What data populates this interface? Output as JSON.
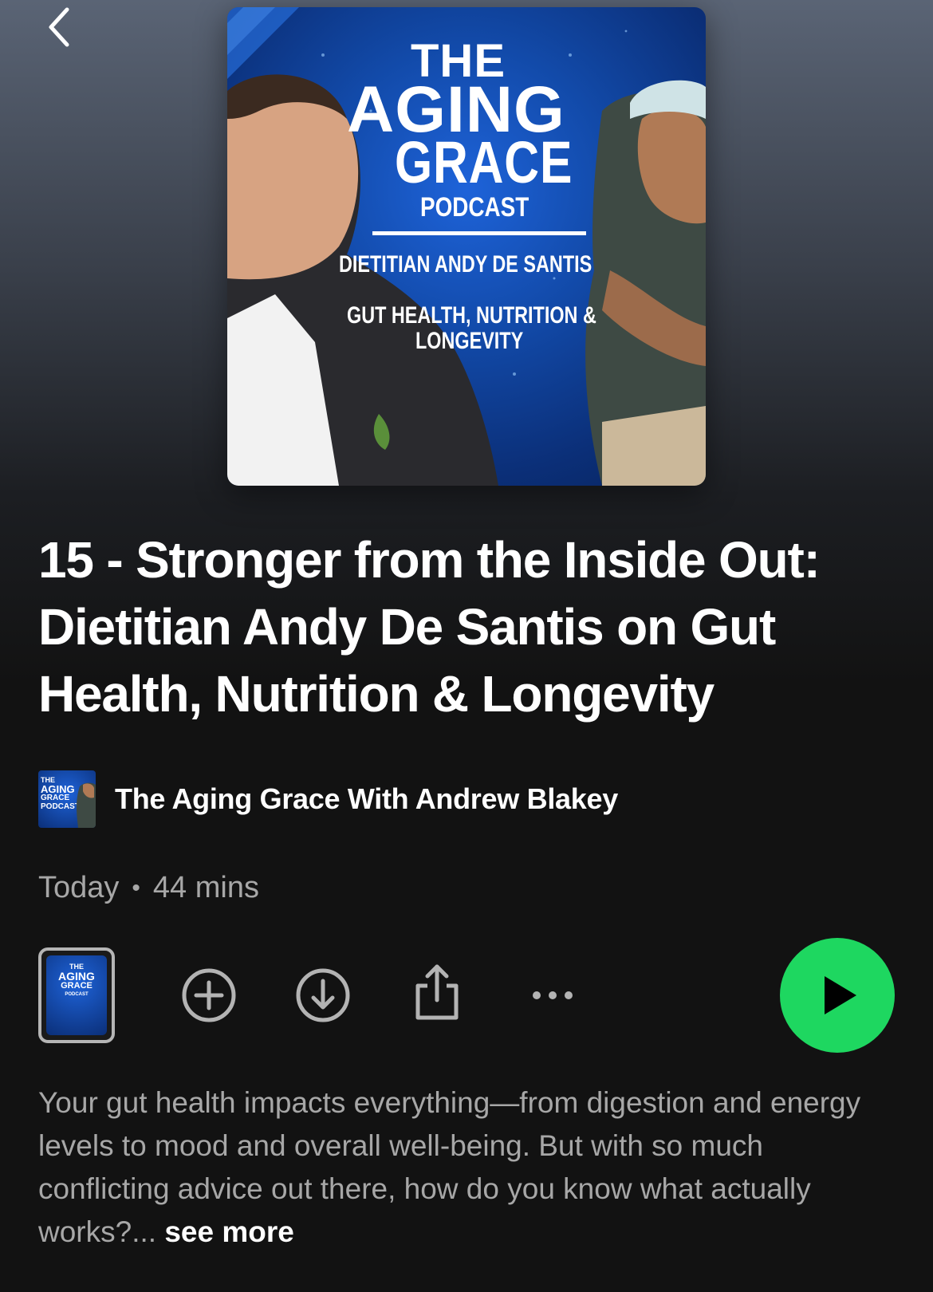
{
  "nav": {
    "back_icon": "chevron-left-icon"
  },
  "cover": {
    "line_the": "THE",
    "line_aging": "AGING",
    "line_grace": "GRACE",
    "line_podcast": "PODCAST",
    "guest_line": "DIETITIAN ANDY DE SANTIS",
    "topic_line1": "GUT HEALTH, NUTRITION &",
    "topic_line2": "LONGEVITY"
  },
  "episode": {
    "title": "15 - Stronger from the Inside Out: Dietitian Andy De Santis on Gut Health, Nutrition & Longevity",
    "date": "Today",
    "separator": "•",
    "duration": "44 mins"
  },
  "show": {
    "name": "The Aging Grace With Andrew Blakey",
    "thumb_the": "THE",
    "thumb_aging": "AGING",
    "thumb_grace": "GRACE",
    "thumb_podcast": "PODCAST"
  },
  "actions": {
    "add_icon": "plus-circle-icon",
    "download_icon": "download-circle-icon",
    "share_icon": "share-icon",
    "more_icon": "more-horizontal-icon",
    "play_icon": "play-icon"
  },
  "description": {
    "text": "Your gut health impacts everything—from digestion and energy levels to mood and overall well-being. But with so much conflicting advice out there, how do you know what actually works?...",
    "see_more": "see more"
  },
  "colors": {
    "accent": "#1ed760",
    "background": "#121212",
    "secondary_text": "#a7a7a7",
    "cover_blue": "#124aa9"
  }
}
